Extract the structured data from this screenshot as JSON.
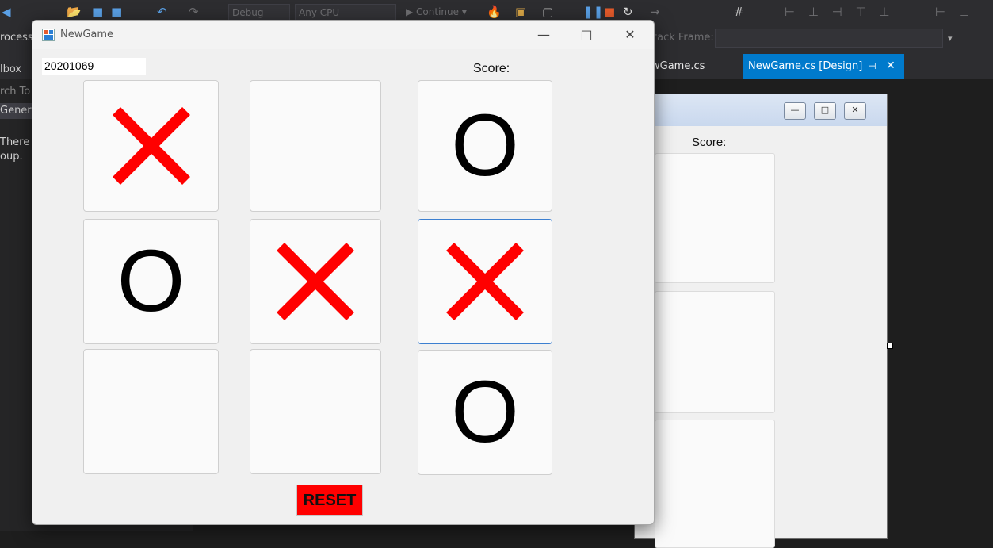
{
  "ide": {
    "toolbar": {
      "config": "Debug",
      "platform": "Any CPU",
      "continue_label": "▶ Continue ▾",
      "stack_frame_label": "tack Frame:"
    },
    "left_panel": {
      "process_label": "rocess",
      "toolbox_label": "lbox",
      "search_label": "rch To",
      "general_label": "Genera",
      "empty_line1": "There",
      "empty_line2": "oup. "
    },
    "tabs": [
      {
        "label": "wGame.cs",
        "active": false
      },
      {
        "label": "NewGame.cs [Design]",
        "active": true,
        "pin_icon": "pin-icon",
        "close_icon": "close-icon"
      }
    ],
    "accent_color": "#007acc"
  },
  "designer_form": {
    "score_label": "Score:",
    "minimize_glyph": "—",
    "maximize_glyph": "□",
    "close_glyph": "✕"
  },
  "window": {
    "title": "NewGame",
    "app_icon": "winforms-app-icon",
    "minimize_glyph": "—",
    "maximize_glyph": "□",
    "close_glyph": "✕",
    "id_value": "20201069",
    "score_label": "Score:",
    "board": [
      "X",
      "",
      "O",
      "O",
      "X",
      "X",
      "",
      "",
      "O"
    ],
    "focused_cell": 5,
    "x_color": "#ff0000",
    "o_color": "#000000",
    "reset_label": "RESET",
    "reset_color": "#ff0000"
  }
}
